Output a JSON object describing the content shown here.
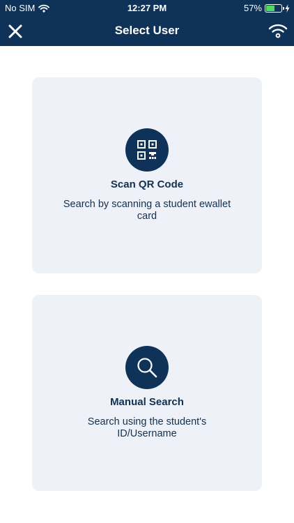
{
  "status_bar": {
    "carrier": "No SIM",
    "time": "12:27 PM",
    "battery_percent": "57%",
    "battery_level": 0.57,
    "battery_color": "#4cd964"
  },
  "nav": {
    "title": "Select User",
    "close_icon": "close-icon",
    "wifi_icon": "wifi-icon",
    "background_color": "#0f3358"
  },
  "options": [
    {
      "title": "Scan QR Code",
      "description": "Search by scanning a student ewallet card",
      "icon": "qr-code-icon"
    },
    {
      "title": "Manual Search",
      "description": "Search using the student's ID/Username",
      "icon": "search-icon"
    }
  ],
  "colors": {
    "accent": "#0f3358",
    "card_background": "#eef2f8",
    "text": "#12304f"
  }
}
